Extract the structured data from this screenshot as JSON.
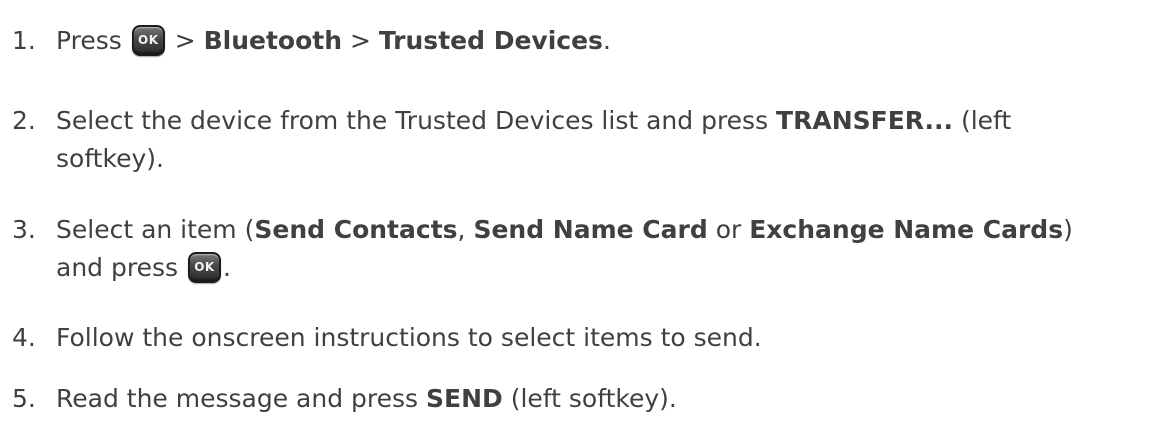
{
  "steps": [
    {
      "number": "1.",
      "parts": {
        "a": "Press ",
        "b": " > ",
        "c": "Bluetooth",
        "d": " > ",
        "e": "Trusted Devices",
        "f": "."
      }
    },
    {
      "number": "2.",
      "parts": {
        "a": "Select the device from the Trusted Devices list and press ",
        "b": "TRANSFER...",
        "c": " (left",
        "d": "softkey)."
      }
    },
    {
      "number": "3.",
      "parts": {
        "a": "Select an item (",
        "b": "Send Contacts",
        "c": ", ",
        "d": "Send Name Card",
        "e": " or ",
        "f": "Exchange Name Cards",
        "g": ")",
        "h": "and press ",
        "i": "."
      }
    },
    {
      "number": "4.",
      "parts": {
        "a": "Follow the onscreen instructions to select items to send."
      }
    },
    {
      "number": "5.",
      "parts": {
        "a": "Read the message and press ",
        "b": "SEND",
        "c": " (left softkey)."
      }
    }
  ],
  "keys": {
    "ok_label": "OK"
  }
}
